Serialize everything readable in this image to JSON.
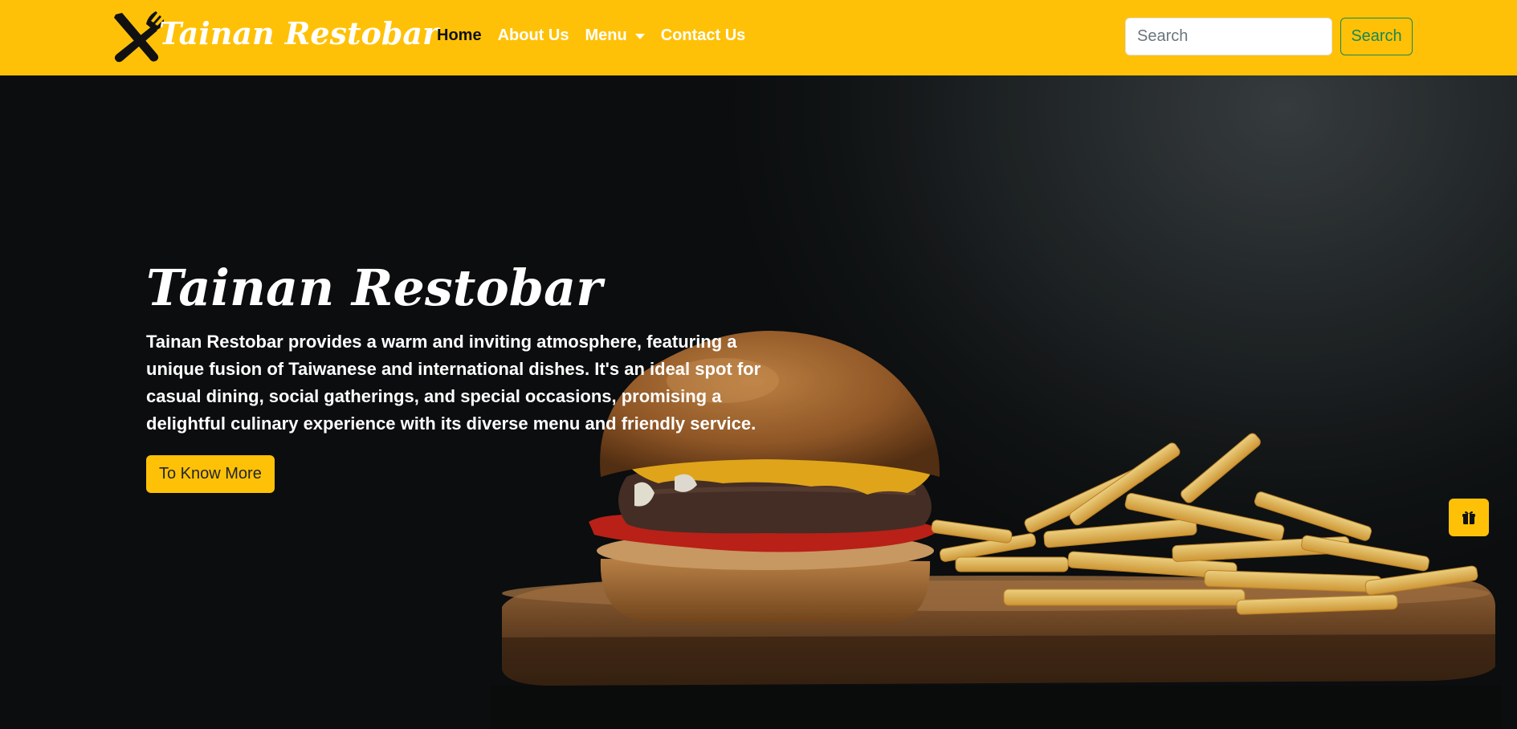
{
  "brand": {
    "name": "Tainan Restobar",
    "icon": "fork-knife-crossed-icon"
  },
  "nav": {
    "items": [
      {
        "label": "Home",
        "active": true
      },
      {
        "label": "About Us",
        "active": false
      },
      {
        "label": "Menu",
        "active": false,
        "dropdown": true
      },
      {
        "label": "Contact Us",
        "active": false
      }
    ]
  },
  "search": {
    "placeholder": "Search",
    "button_label": "Search"
  },
  "hero": {
    "title": "Tainan Restobar",
    "description": "Tainan Restobar provides a warm and inviting atmosphere, featuring a unique fusion of Taiwanese and international dishes. It's an ideal spot for casual dining, social gatherings, and special occasions, promising a delightful culinary experience with its diverse menu and friendly service.",
    "cta_label": "To Know More",
    "background_image": "burger-and-fries-on-wooden-board"
  },
  "floating": {
    "icon": "gift-icon"
  },
  "colors": {
    "accent": "#ffc107",
    "success": "#198754",
    "hero_bg": "#0d0f10",
    "text_light": "#ffffff"
  }
}
